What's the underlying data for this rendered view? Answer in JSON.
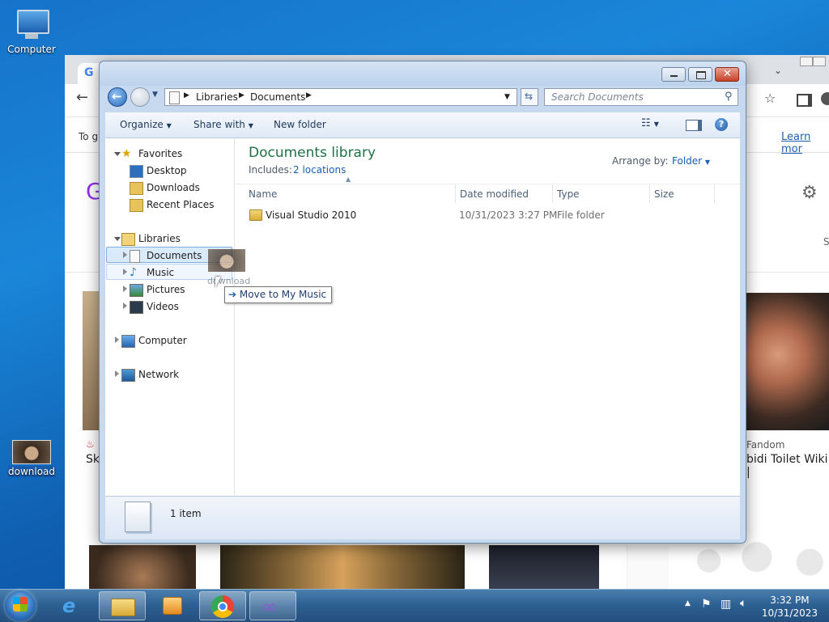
{
  "desktop": {
    "icons": [
      {
        "label": "Computer"
      },
      {
        "label": "download"
      }
    ]
  },
  "chrome": {
    "notice": "To g",
    "learn_more": "Learn mor",
    "result_source": "Fandom",
    "result_title": "bidi Toilet Wiki |",
    "left_snippet": "Sk",
    "right_s": "S"
  },
  "explorer": {
    "breadcrumb": [
      "Libraries",
      "Documents"
    ],
    "search_placeholder": "Search Documents",
    "toolbar": {
      "organize": "Organize",
      "share_with": "Share with",
      "new_folder": "New folder"
    },
    "nav": {
      "favorites": "Favorites",
      "desktop": "Desktop",
      "downloads": "Downloads",
      "recent_places": "Recent Places",
      "libraries": "Libraries",
      "documents": "Documents",
      "music": "Music",
      "pictures": "Pictures",
      "videos": "Videos",
      "computer": "Computer",
      "network": "Network"
    },
    "library_title": "Documents library",
    "includes_label": "Includes:",
    "includes_link": "2 locations",
    "arrange_label": "Arrange by:",
    "arrange_value": "Folder",
    "columns": [
      "Name",
      "Date modified",
      "Type",
      "Size"
    ],
    "files": [
      {
        "name": "Visual Studio 2010",
        "date": "10/31/2023 3:27 PM",
        "type": "File folder",
        "size": ""
      }
    ],
    "status_count": "1 item",
    "drag_tooltip": "Move to My Music",
    "drag_label": "download"
  },
  "taskbar": {
    "time": "3:32 PM",
    "date": "10/31/2023"
  },
  "colors": {
    "library_title": "#1e7145",
    "link": "#1a5fb4",
    "selection": "#cce4f7"
  }
}
